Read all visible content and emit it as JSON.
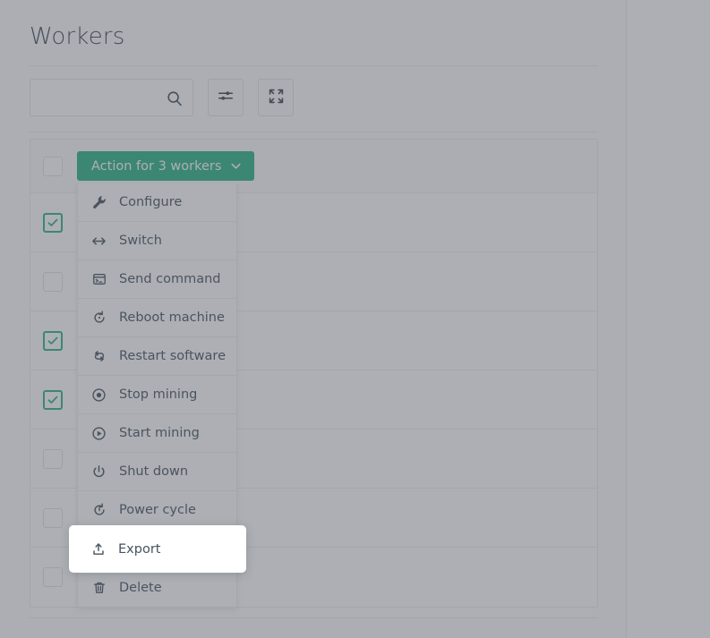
{
  "page": {
    "title": "Workers"
  },
  "toolbar": {
    "search_placeholder": "",
    "search_value": "",
    "search_icon": "search-icon",
    "filter_icon": "sliders-icon",
    "expand_icon": "fullscreen-icon"
  },
  "action": {
    "label": "Action for 3 workers",
    "caret_icon": "chevron-down-icon",
    "selected_count": 3,
    "color": "#2bb186"
  },
  "menu": {
    "items": [
      {
        "label": "Configure",
        "icon": "wrench-icon",
        "highlighted": false
      },
      {
        "label": "Switch",
        "icon": "arrows-horizontal-icon",
        "highlighted": false
      },
      {
        "label": "Send command",
        "icon": "terminal-window-icon",
        "highlighted": false
      },
      {
        "label": "Reboot machine",
        "icon": "reload-icon",
        "highlighted": false
      },
      {
        "label": "Restart software",
        "icon": "refresh-icon",
        "highlighted": false
      },
      {
        "label": "Stop mining",
        "icon": "stop-circle-icon",
        "highlighted": false
      },
      {
        "label": "Start mining",
        "icon": "play-circle-icon",
        "highlighted": false
      },
      {
        "label": "Shut down",
        "icon": "power-icon",
        "highlighted": false
      },
      {
        "label": "Power cycle",
        "icon": "power-cycle-icon",
        "highlighted": false
      },
      {
        "label": "Export",
        "icon": "upload-icon",
        "highlighted": true
      },
      {
        "label": "Delete",
        "icon": "trash-icon",
        "highlighted": false
      }
    ]
  },
  "hovered": {
    "label": "Export",
    "icon": "upload-icon"
  },
  "table": {
    "select_all_checked": false,
    "rows": [
      {
        "checked": true
      },
      {
        "checked": false
      },
      {
        "checked": true
      },
      {
        "checked": true
      },
      {
        "checked": false
      },
      {
        "checked": false
      },
      {
        "checked": false
      }
    ]
  },
  "colors": {
    "accent_green": "#2bb186",
    "text": "#46535f",
    "scrim": "rgba(80,86,96,0.47)"
  }
}
